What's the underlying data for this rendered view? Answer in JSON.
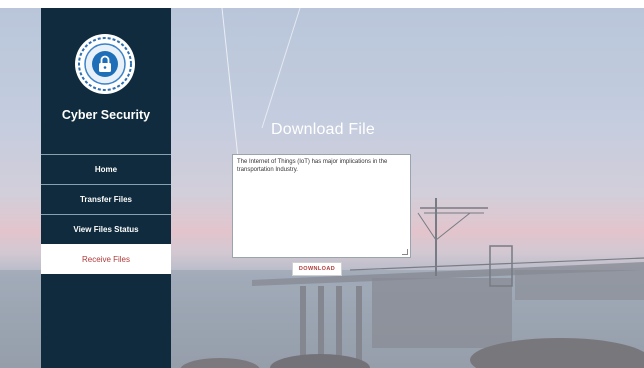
{
  "sidebar": {
    "brand": "Cyber Security",
    "logo_icon": "lock-shield-icon",
    "items": [
      {
        "label": "Home",
        "active": false
      },
      {
        "label": "Transfer Files",
        "active": false
      },
      {
        "label": "View Files Status",
        "active": false
      },
      {
        "label": "Receive Files",
        "active": true
      }
    ]
  },
  "main": {
    "title": "Download File",
    "file_content": "The Internet of Things (IoT) has major implications in the transportation Industry.",
    "download_label": "DOWNLOAD"
  },
  "colors": {
    "sidebar_bg": "#0f2b3d",
    "active_text": "#b03a3a"
  }
}
